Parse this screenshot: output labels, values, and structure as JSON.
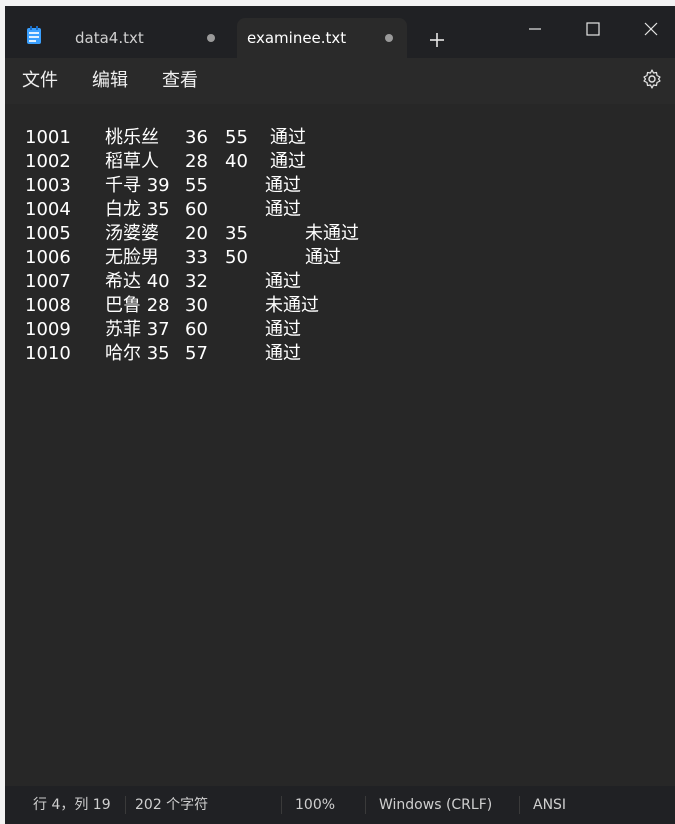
{
  "tabs": [
    {
      "title": "data4.txt",
      "modified": true,
      "active": false
    },
    {
      "title": "examinee.txt",
      "modified": true,
      "active": true
    }
  ],
  "menu": [
    "文件",
    "编辑",
    "查看"
  ],
  "editor_lines": [
    {
      "id": "1001",
      "name": "桃乐丝",
      "s1": "36",
      "s2": "55",
      "result": "通过"
    },
    {
      "id": "1002",
      "name": "稻草人",
      "s1": "28",
      "s2": "40",
      "result": "通过"
    },
    {
      "id": "1003",
      "name": "千寻 39",
      "s1": "55",
      "s2": "",
      "result": "通过"
    },
    {
      "id": "1004",
      "name": "白龙 35",
      "s1": "60",
      "s2": "",
      "result": "通过"
    },
    {
      "id": "1005",
      "name": "汤婆婆",
      "s1": "20",
      "s2": "35",
      "result": "未通过"
    },
    {
      "id": "1006",
      "name": "无脸男",
      "s1": "33",
      "s2": "50",
      "result": "通过"
    },
    {
      "id": "1007",
      "name": "希达 40",
      "s1": "32",
      "s2": "",
      "result": "通过"
    },
    {
      "id": "1008",
      "name": "巴鲁 28",
      "s1": "30",
      "s2": "",
      "result": "未通过"
    },
    {
      "id": "1009",
      "name": "苏菲 37",
      "s1": "60",
      "s2": "",
      "result": "通过"
    },
    {
      "id": "1010",
      "name": "哈尔 35",
      "s1": "57",
      "s2": "",
      "result": "通过"
    }
  ],
  "status": {
    "position": "行 4，列 19",
    "chars": "202 个字符",
    "zoom": "100%",
    "line_ending": "Windows (CRLF)",
    "encoding": "ANSI"
  },
  "icons": {
    "app": "notepad-icon",
    "new_tab": "plus-icon",
    "minimize": "minimize-icon",
    "maximize": "maximize-icon",
    "close": "close-icon",
    "settings": "gear-icon"
  }
}
